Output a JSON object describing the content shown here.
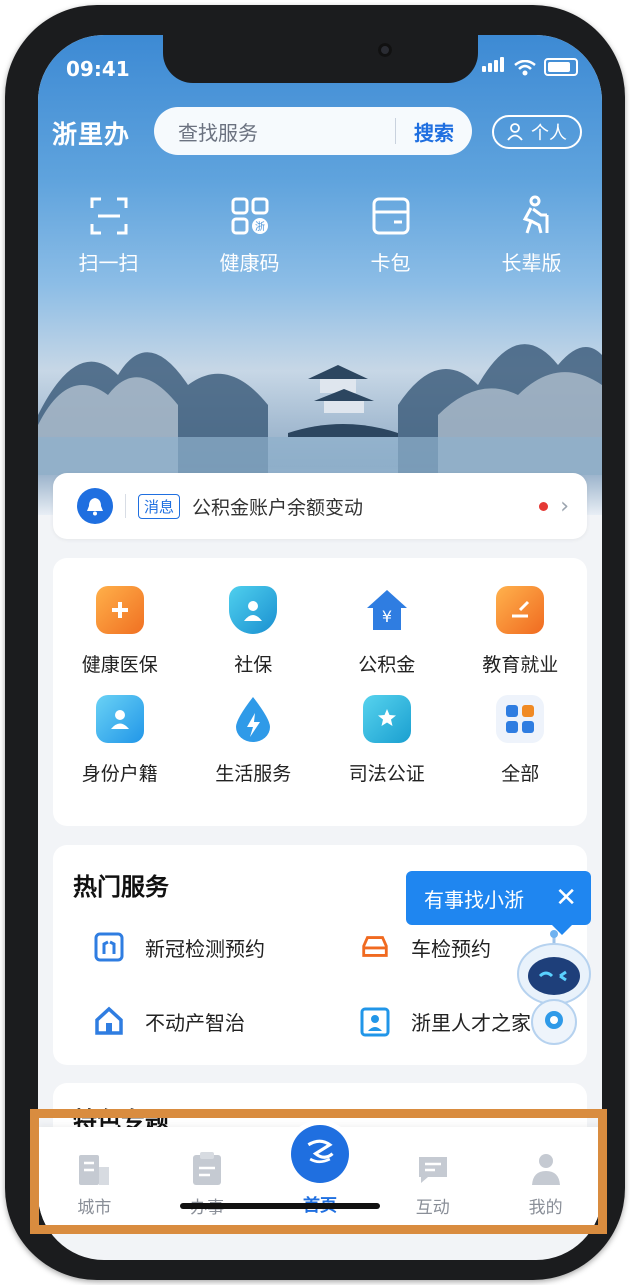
{
  "status_bar": {
    "time": "09:41"
  },
  "header": {
    "logo": "浙里办",
    "search": {
      "placeholder": "查找服务",
      "button": "搜索"
    },
    "personal_button": "个人"
  },
  "quick_actions": [
    {
      "label": "扫一扫",
      "icon": "scan-icon"
    },
    {
      "label": "健康码",
      "icon": "health-code-icon",
      "badge": "浙"
    },
    {
      "label": "卡包",
      "icon": "card-wallet-icon"
    },
    {
      "label": "长辈版",
      "icon": "elder-mode-icon"
    }
  ],
  "message_bar": {
    "tag": "消息",
    "text": "公积金账户余额变动"
  },
  "services": [
    {
      "label": "健康医保",
      "icon": "medical-kit-icon",
      "color": "#f08a24"
    },
    {
      "label": "社保",
      "icon": "shield-person-icon",
      "color": "#22a6d6"
    },
    {
      "label": "公积金",
      "icon": "house-yuan-icon",
      "color": "#2f7de1"
    },
    {
      "label": "教育就业",
      "icon": "diploma-icon",
      "color": "#f07a2a"
    },
    {
      "label": "身份户籍",
      "icon": "id-folder-icon",
      "color": "#2aa0e8"
    },
    {
      "label": "生活服务",
      "icon": "water-drop-icon",
      "color": "#2f9ae8"
    },
    {
      "label": "司法公证",
      "icon": "certificate-icon",
      "color": "#21b0d6"
    },
    {
      "label": "全部",
      "icon": "grid-all-icon",
      "color": "#2f7de1"
    }
  ],
  "hot_services": {
    "title": "热门服务",
    "items": [
      {
        "label": "新冠检测预约",
        "icon": "lungs-icon"
      },
      {
        "label": "车检预约",
        "icon": "car-icon"
      },
      {
        "label": "不动产智治",
        "icon": "home-icon"
      },
      {
        "label": "浙里人才之家",
        "icon": "talent-badge-icon"
      }
    ]
  },
  "assistant": {
    "bubble_text": "有事找小浙",
    "close": "✕"
  },
  "special_topics": {
    "title": "特色专题"
  },
  "tab_bar": {
    "items": [
      {
        "label": "城市",
        "icon": "city-icon",
        "active": false
      },
      {
        "label": "办事",
        "icon": "clipboard-icon",
        "active": false
      },
      {
        "label": "首页",
        "icon": "home-logo-icon",
        "active": true
      },
      {
        "label": "互动",
        "icon": "chat-icon",
        "active": false
      },
      {
        "label": "我的",
        "icon": "user-icon",
        "active": false
      }
    ]
  },
  "colors": {
    "brand_blue": "#1f6fe0",
    "highlight_border": "#d98c3f",
    "notification_dot": "#e53935"
  }
}
